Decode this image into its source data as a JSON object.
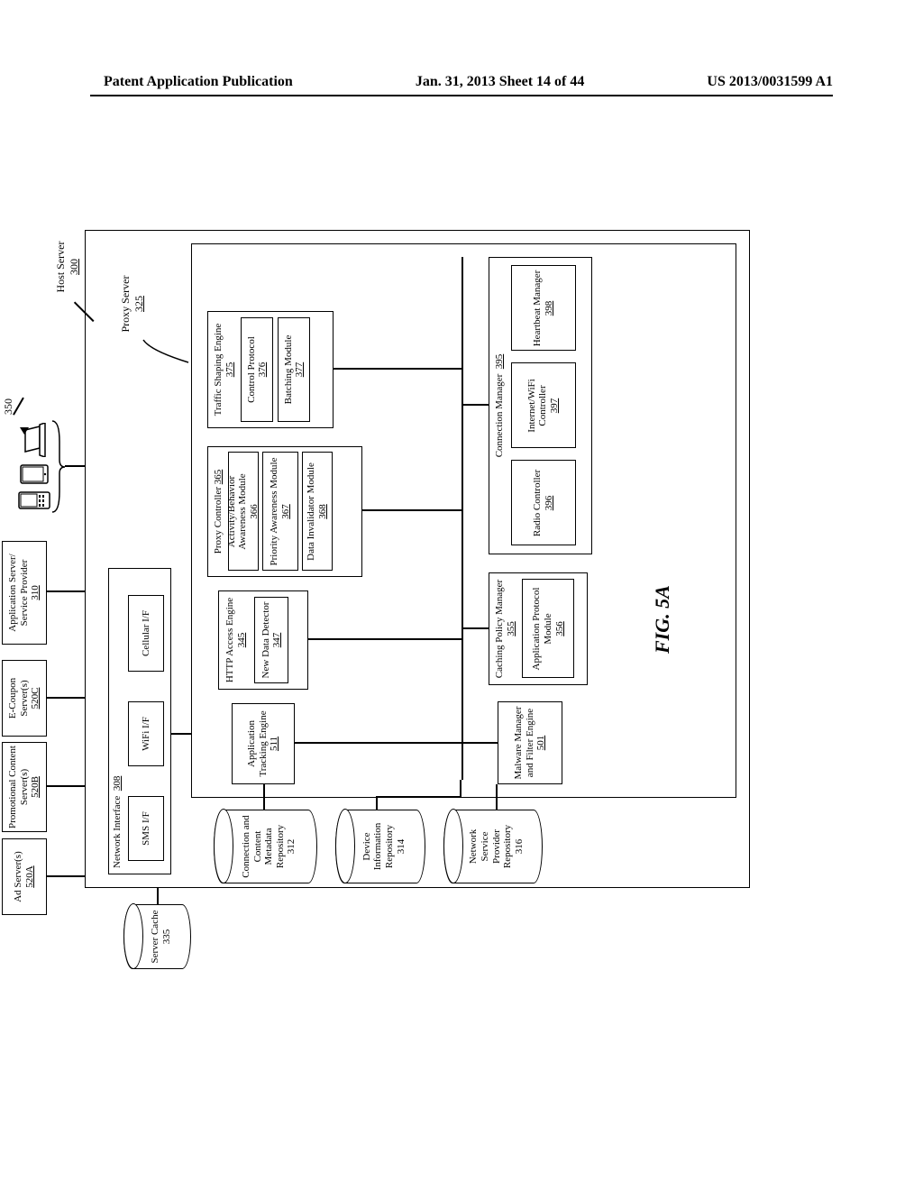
{
  "header": {
    "left": "Patent Application Publication",
    "center": "Jan. 31, 2013  Sheet 14 of 44",
    "right": "US 2013/0031599 A1"
  },
  "figure_label": "FIG. 5A",
  "top": {
    "ad_servers": {
      "title": "Ad Server(s)",
      "ref": "520A"
    },
    "promo_servers": {
      "title": "Promotional Content Server(s)",
      "ref": "520B"
    },
    "ecoupon_servers": {
      "title": "E-Coupon Server(s)",
      "ref": "520C"
    },
    "app_server": {
      "title": "Application Server/ Service Provider",
      "ref": "310"
    }
  },
  "devices_ref": "350",
  "host_server": {
    "title": "Host Server",
    "ref": "300"
  },
  "proxy_server": {
    "title": "Proxy Server",
    "ref": "325"
  },
  "server_cache": {
    "title": "Server Cache",
    "ref": "335"
  },
  "network_interface": {
    "title": "Network Interface",
    "ref": "308"
  },
  "ifaces": {
    "sms": "SMS I/F",
    "wifi": "WiFi I/F",
    "cellular": "Cellular I/F"
  },
  "repos": {
    "conn_meta": {
      "title": "Connection and Content Metadata Repository",
      "ref": "312"
    },
    "dev_info": {
      "title": "Device Information Repository",
      "ref": "314"
    },
    "net_svc": {
      "title": "Network Service Provider Repository",
      "ref": "316"
    }
  },
  "modules": {
    "app_tracking": {
      "title": "Application Tracking Engine",
      "ref": "511"
    },
    "malware": {
      "title": "Malware Manager and Filter Engine",
      "ref": "501"
    },
    "http_access": {
      "title": "HTTP Access Engine",
      "ref": "345"
    },
    "new_data": {
      "title": "New Data Detector",
      "ref": "347"
    },
    "proxy_ctrl": {
      "title": "Proxy Controller",
      "ref": "365"
    },
    "activity": {
      "title": "Activity/Behavior Awareness Module",
      "ref": "366"
    },
    "priority": {
      "title": "Priority Awareness Module",
      "ref": "367"
    },
    "data_inval": {
      "title": "Data Invalidator Module",
      "ref": "368"
    },
    "traffic_shaping": {
      "title": "Traffic Shaping Engine",
      "ref": "375"
    },
    "control_proto": {
      "title": "Control Protocol",
      "ref": "376"
    },
    "batching": {
      "title": "Batching Module",
      "ref": "377"
    },
    "caching_policy": {
      "title": "Caching Policy Manager",
      "ref": "355"
    },
    "app_protocol": {
      "title": "Application Protocol Module",
      "ref": "356"
    },
    "conn_mgr": {
      "title": "Connection Manager",
      "ref": "395"
    },
    "radio": {
      "title": "Radio Controller",
      "ref": "396"
    },
    "internet_wifi": {
      "title": "Internet/WiFi Controller",
      "ref": "397"
    },
    "heartbeat": {
      "title": "Heartbeat Manager",
      "ref": "398"
    }
  }
}
